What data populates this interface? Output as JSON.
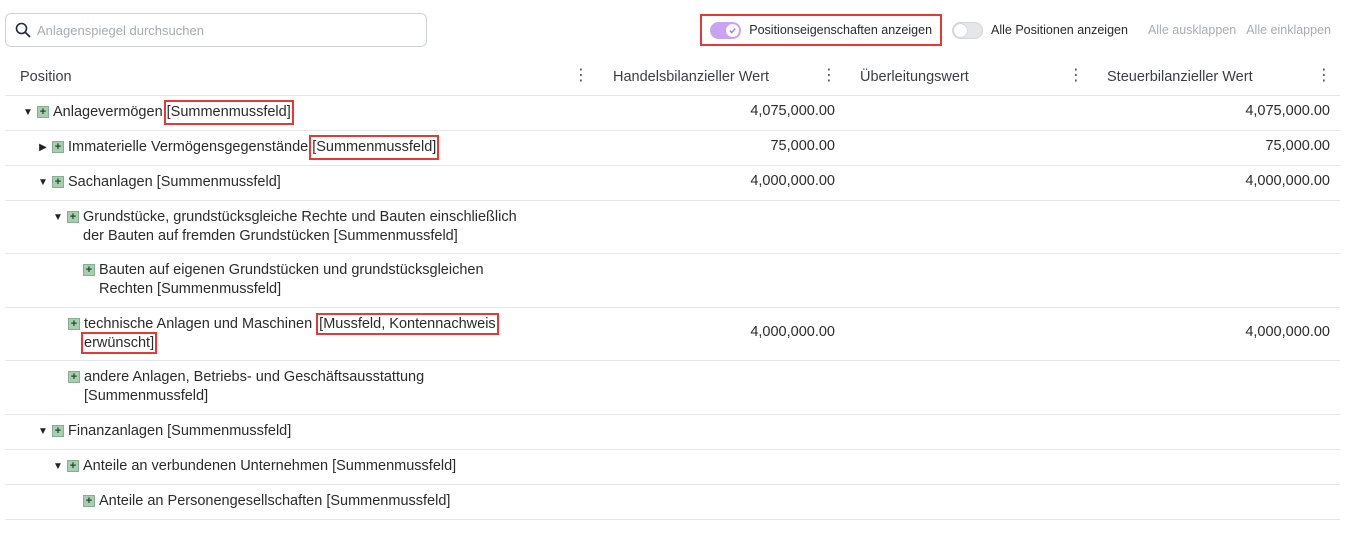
{
  "search": {
    "placeholder": "Anlagenspiegel durchsuchen"
  },
  "toolbar": {
    "toggle_props_label": "Positionseigenschaften anzeigen",
    "toggle_all_label": "Alle Positionen anzeigen",
    "expand_all": "Alle ausklappen",
    "collapse_all": "Alle einklappen"
  },
  "columns": [
    "Position",
    "Handelsbilanzieller Wert",
    "Überleitungswert",
    "Steuerbilanzieller Wert"
  ],
  "rows": [
    {
      "label": "Anlagevermögen",
      "tag": "[Summenmussfeld]",
      "handel": "4,075,000.00",
      "ueber": "",
      "steuer": "4,075,000.00"
    },
    {
      "label": "Immaterielle Vermögensgegenstände",
      "tag": "[Summenmussfeld]",
      "handel": "75,000.00",
      "ueber": "",
      "steuer": "75,000.00"
    },
    {
      "label": "Sachanlagen [Summenmussfeld]",
      "handel": "4,000,000.00",
      "ueber": "",
      "steuer": "4,000,000.00"
    },
    {
      "line1": "Grundstücke, grundstücksgleiche Rechte und Bauten einschließlich",
      "line2": "der Bauten auf fremden Grundstücken [Summenmussfeld]",
      "handel": "",
      "ueber": "",
      "steuer": ""
    },
    {
      "line1": "Bauten auf eigenen Grundstücken und grundstücksgleichen",
      "line2": "Rechten [Summenmussfeld]",
      "handel": "",
      "ueber": "",
      "steuer": ""
    },
    {
      "label": "technische Anlagen und Maschinen",
      "tag1": "[Mussfeld, Kontennachweis",
      "tag2": "erwünscht]",
      "handel": "4,000,000.00",
      "ueber": "",
      "steuer": "4,000,000.00"
    },
    {
      "line1": "andere Anlagen, Betriebs- und Geschäftsausstattung",
      "line2": "[Summenmussfeld]",
      "handel": "",
      "ueber": "",
      "steuer": ""
    },
    {
      "label": "Finanzanlagen [Summenmussfeld]",
      "handel": "",
      "ueber": "",
      "steuer": ""
    },
    {
      "label": "Anteile an verbundenen Unternehmen [Summenmussfeld]",
      "handel": "",
      "ueber": "",
      "steuer": ""
    },
    {
      "label": "Anteile an Personengesellschaften [Summenmussfeld]",
      "handel": "",
      "ueber": "",
      "steuer": ""
    }
  ]
}
